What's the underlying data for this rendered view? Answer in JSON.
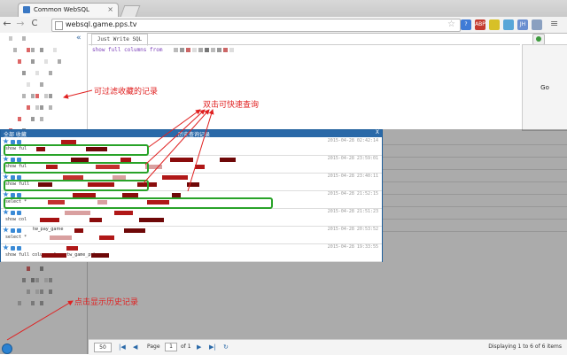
{
  "browser": {
    "tab_title": "Common WebSQL",
    "tab_close": "×",
    "url": "websql.game.pps.tv",
    "nav": {
      "back": "←",
      "forward": "→",
      "reload": "C"
    },
    "extensions": [
      {
        "label": "?",
        "color": "#3f7bd6"
      },
      {
        "label": "ABP",
        "color": "#c43b2f"
      },
      {
        "label": "",
        "color": "#d7c027"
      },
      {
        "label": "",
        "color": "#58a6d8"
      },
      {
        "label": "JH",
        "color": "#6b8fd0"
      },
      {
        "label": "",
        "color": "#8aa0c0"
      }
    ]
  },
  "sidebar": {
    "collapse_label": "«"
  },
  "editor": {
    "tab_label": "Just Write SQL",
    "sql_text": "show full columns from"
  },
  "go_button": {
    "label": "Go"
  },
  "history_popup": {
    "header_left": "全部 收藏",
    "title": "历史查询记录",
    "close": "X",
    "rows": [
      {
        "sql": "show ful",
        "time": "2015-04-28 02:42:14",
        "highlight": true
      },
      {
        "sql": "show ful",
        "time": "2015-04-28 23:59:01",
        "highlight": true
      },
      {
        "sql": "show full",
        "time": "2015-04-28 23:40:11",
        "highlight": true
      },
      {
        "sql": "select *",
        "time": "2015-04-28 21:52:15",
        "highlight": true
      },
      {
        "sql": "show col",
        "time": "2015-04-28 21:51:23",
        "highlight": false
      },
      {
        "sql": "select *",
        "time": "2015-04-28 20:53:52",
        "highlight": false
      },
      {
        "sql": "show full columns from tw_game_pubsu_u",
        "time": "2015-04-28 19:33:55",
        "highlight": false
      }
    ],
    "tag_name": "tw_pay_game"
  },
  "pager": {
    "page_size": "50",
    "page_label": "Page",
    "page_value": "1",
    "of_label": "of 1",
    "display_text": "Displaying 1 to 6 of 6 items"
  },
  "annotations": {
    "filter": "可过滤收藏的记录",
    "dblclick": "双击可快速查询",
    "history": "点击显示历史记录"
  }
}
